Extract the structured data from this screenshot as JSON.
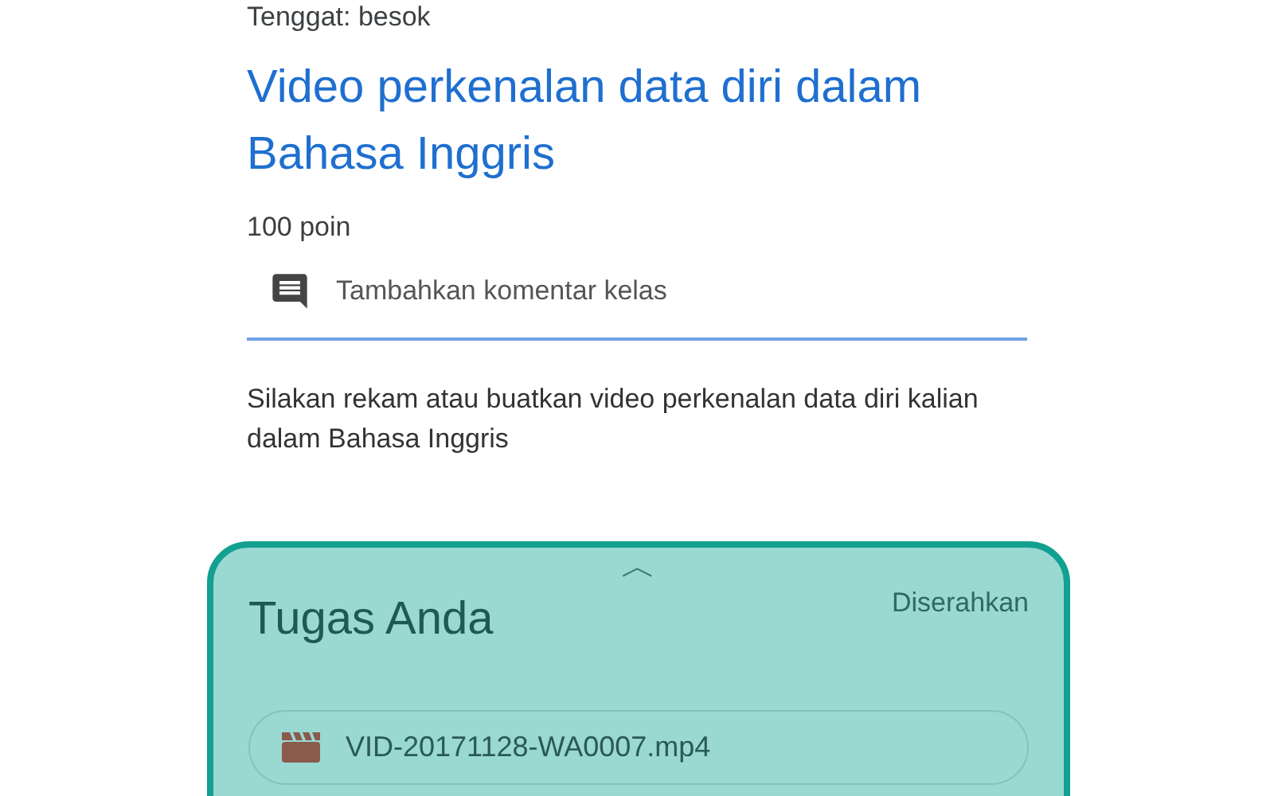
{
  "due": "Tenggat: besok",
  "title": "Video perkenalan data diri dalam Bahasa Inggris",
  "points": "100 poin",
  "comment": {
    "label": "Tambahkan komentar kelas"
  },
  "description": "Silakan rekam atau buatkan video perkenalan data diri kalian dalam Bahasa Inggris",
  "work_panel": {
    "handle": "︿",
    "title": "Tugas Anda",
    "status": "Diserahkan",
    "attachments": [
      {
        "kind": "video",
        "name": "VID-20171128-WA0007.mp4"
      }
    ]
  }
}
